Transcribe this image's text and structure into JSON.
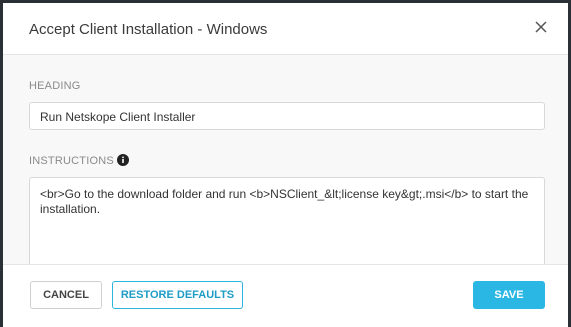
{
  "dialog": {
    "title": "Accept Client Installation - Windows",
    "close_icon": "close-icon"
  },
  "fields": {
    "heading_label": "HEADING",
    "heading_value": "Run Netskope Client Installer",
    "instructions_label": "INSTRUCTIONS",
    "instructions_info_icon": "info-icon",
    "instructions_value": "<br>Go to the download folder and run <b>NSClient_&lt;license key&gt;.msi</b> to start the installation."
  },
  "footer": {
    "cancel_label": "CANCEL",
    "restore_label": "RESTORE DEFAULTS",
    "save_label": "SAVE"
  },
  "colors": {
    "accent": "#2bb7e3",
    "overlay": "#2b2f36"
  }
}
